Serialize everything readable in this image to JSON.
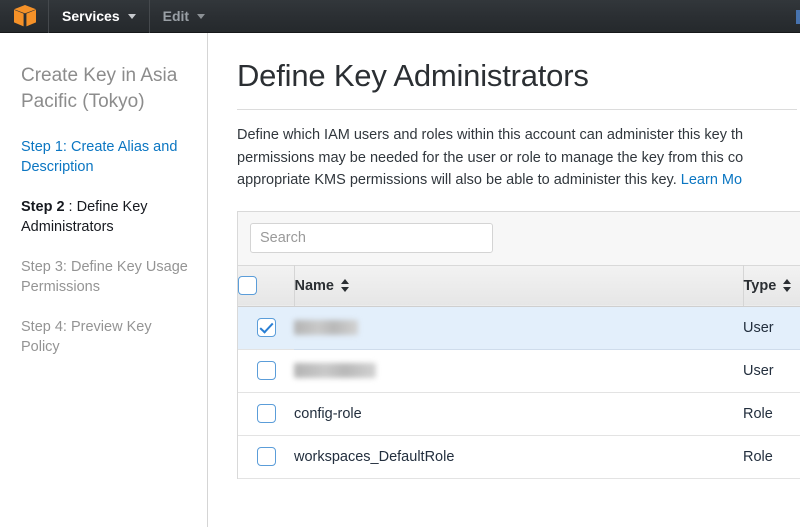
{
  "navbar": {
    "logo_icon": "aws-cube-icon",
    "services_label": "Services",
    "services_caret_icon": "chevron-down-icon",
    "edit_label": "Edit",
    "edit_caret_icon": "chevron-down-icon",
    "background_color": "#2b2f33"
  },
  "sidebar": {
    "title": "Create Key in Asia Pacific (Tokyo)",
    "steps": [
      {
        "prefix": "",
        "label": "Step 1: Create Alias and Description",
        "state": "link"
      },
      {
        "prefix": "Step 2",
        "label": " : Define Key Administrators",
        "state": "active"
      },
      {
        "prefix": "",
        "label": "Step 3: Define Key Usage Permissions",
        "state": "future"
      },
      {
        "prefix": "",
        "label": "Step 4: Preview Key Policy",
        "state": "future"
      }
    ],
    "link_color": "#0b76c2"
  },
  "main": {
    "page_title": "Define Key Administrators",
    "description_line1": "Define which IAM users and roles within this account can administer this key th",
    "description_line2": "permissions may be needed for the user or role to manage the key from this co",
    "description_line3": "appropriate KMS permissions will also be able to administer this key. ",
    "learn_more_label": "Learn Mo",
    "search": {
      "value": "",
      "placeholder": "Search"
    },
    "table": {
      "select_all_checked": false,
      "columns": [
        {
          "label": "Name",
          "sort_icon": "sort-arrows-icon"
        },
        {
          "label": "Type",
          "sort_icon": "sort-arrows-icon"
        }
      ],
      "rows": [
        {
          "checked": true,
          "name": "",
          "redacted": true,
          "redact_width": "w1",
          "type": "User"
        },
        {
          "checked": false,
          "name": "",
          "redacted": true,
          "redact_width": "w2",
          "type": "User"
        },
        {
          "checked": false,
          "name": "config-role",
          "redacted": false,
          "type": "Role"
        },
        {
          "checked": false,
          "name": "workspaces_DefaultRole",
          "redacted": false,
          "type": "Role"
        }
      ]
    }
  }
}
